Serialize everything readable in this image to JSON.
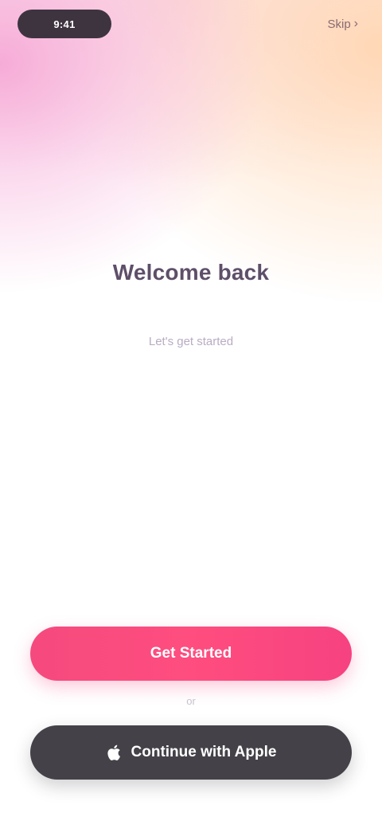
{
  "status_bar": {
    "time_label": "9:41"
  },
  "header": {
    "skip_label": "Skip"
  },
  "hero": {
    "headline": "Welcome back",
    "subtitle": "Let's get started"
  },
  "actions": {
    "primary_label": "Get Started",
    "divider_label": "or",
    "secondary_label": "Continue with Apple"
  },
  "colors": {
    "primary": "#ff4d7f",
    "secondary": "#444248"
  }
}
